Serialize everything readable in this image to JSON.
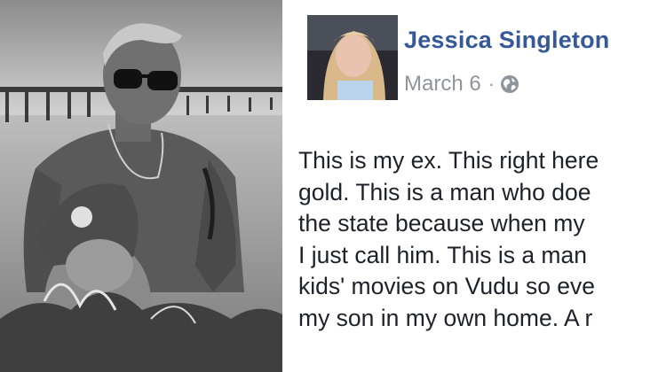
{
  "post": {
    "author_name": "Jessica Singleton",
    "date": "March 6",
    "separator": "·",
    "privacy_icon": "globe-icon",
    "text_lines": [
      "This is my ex. This right here",
      "gold. This is a man who doe",
      "the state because when my",
      "I just call him. This is a man",
      "kids' movies on Vudu so eve",
      "my son in my own home. A r"
    ]
  },
  "colors": {
    "author_link": "#365899",
    "meta_text": "#90949c",
    "body_text": "#1d2129"
  }
}
